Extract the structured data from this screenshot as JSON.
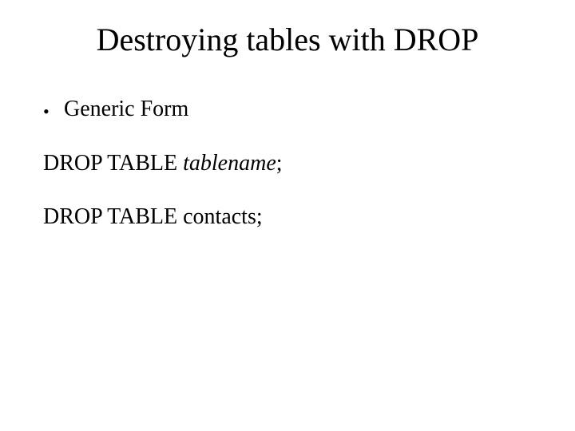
{
  "slide": {
    "title": "Destroying tables with DROP",
    "bullet1": "Generic Form",
    "line1_prefix": "DROP TABLE ",
    "line1_italic": "tablename",
    "line1_suffix": ";",
    "line2": "DROP TABLE contacts;"
  }
}
